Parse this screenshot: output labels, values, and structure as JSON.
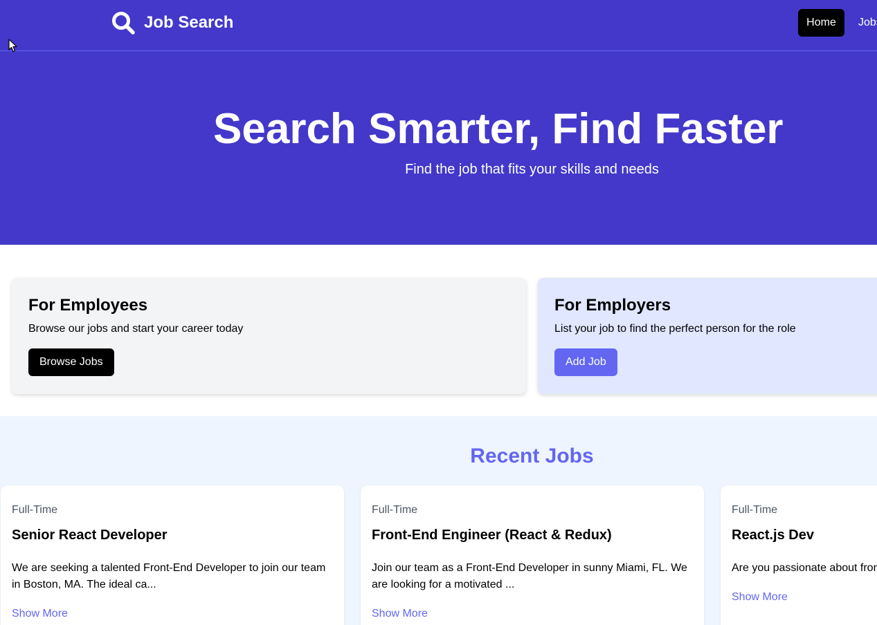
{
  "nav": {
    "brand": "Job Search",
    "links": [
      {
        "label": "Home"
      },
      {
        "label": "Jobs"
      }
    ]
  },
  "hero": {
    "title": "Search Smarter, Find Faster",
    "subtitle": "Find the job that fits your skills and needs"
  },
  "cards": {
    "employees": {
      "title": "For Employees",
      "text": "Browse our jobs and start your career today",
      "button": "Browse Jobs"
    },
    "employers": {
      "title": "For Employers",
      "text": "List your job to find the perfect person for the role",
      "button": "Add Job"
    }
  },
  "recent": {
    "title": "Recent Jobs",
    "jobs": [
      {
        "type": "Full-Time",
        "title": "Senior React Developer",
        "description": "We are seeking a talented Front-End Developer to join our team in Boston, MA. The ideal ca...",
        "more": "Show More"
      },
      {
        "type": "Full-Time",
        "title": "Front-End Engineer (React & Redux)",
        "description": "Join our team as a Front-End Developer in sunny Miami, FL. We are looking for a motivated ...",
        "more": "Show More"
      },
      {
        "type": "Full-Time",
        "title": "React.js Dev",
        "description": "Are you passionate about fron in vibrant Brooklyn, NY, and...",
        "more": "Show More"
      }
    ]
  },
  "colors": {
    "primary": "#4338ca",
    "accent": "#6366f1",
    "employer_card_bg": "#e0e7ff",
    "employee_card_bg": "#f3f4f6",
    "recent_bg": "#eef5ff"
  }
}
